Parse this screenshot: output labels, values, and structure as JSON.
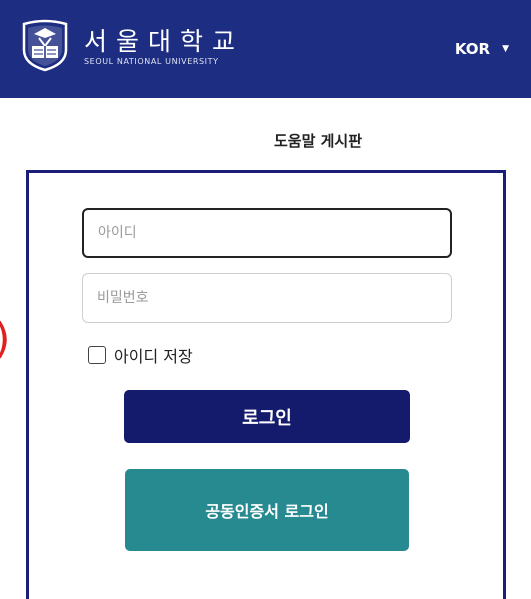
{
  "header": {
    "title_ko": "서울대학교",
    "title_en": "SEOUL NATIONAL UNIVERSITY",
    "language": "KOR",
    "logo_text": [
      "VERITAS",
      "LUX MEA"
    ],
    "colors": {
      "background": "#1d2d82",
      "text": "#ffffff"
    }
  },
  "help_link": "도움말 게시판",
  "login_form": {
    "id_placeholder": "아이디",
    "password_placeholder": "비밀번호",
    "remember_label": "아이디 저장",
    "login_button": "로그인",
    "cert_login_button": "공동인증서 로그인",
    "colors": {
      "login_button": "#141a6c",
      "cert_button": "#268a90",
      "frame": "#1b1f79"
    }
  }
}
